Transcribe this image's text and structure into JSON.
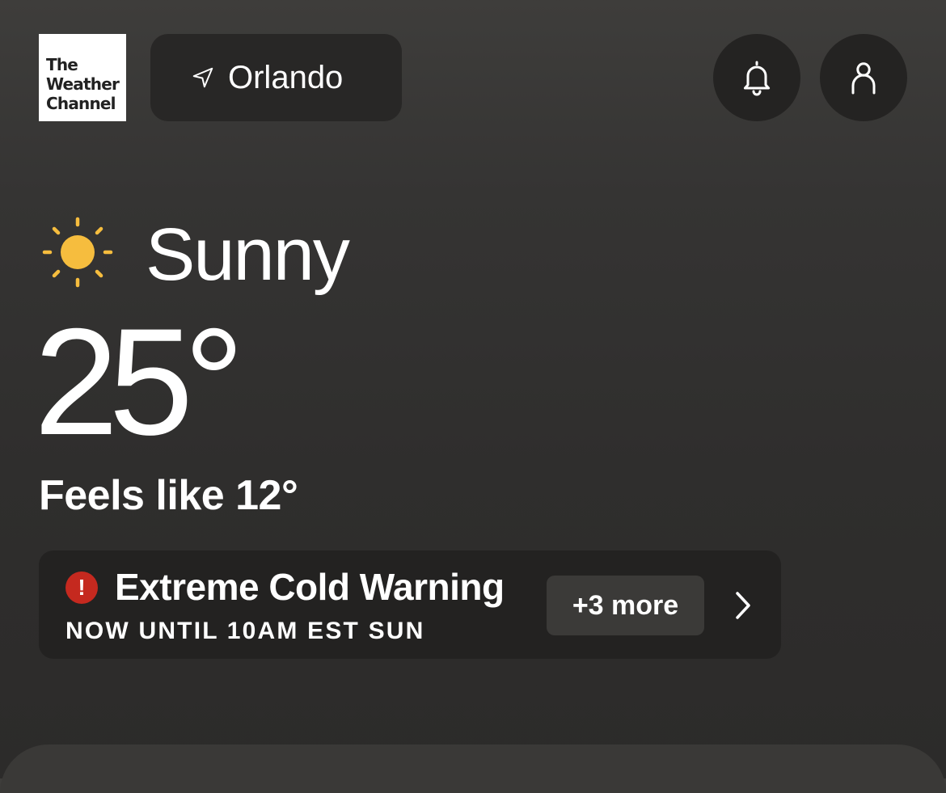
{
  "header": {
    "logo_lines": [
      "The",
      "Weather",
      "Channel"
    ],
    "location": "Orlando",
    "location_icon": "navigation-arrow-icon",
    "notifications_icon": "bell-icon",
    "profile_icon": "person-icon"
  },
  "current": {
    "condition": "Sunny",
    "condition_icon": "sun-icon",
    "temperature": "25°",
    "feels_like": "Feels like 12°"
  },
  "alert": {
    "icon": "exclamation-icon",
    "title": "Extreme Cold Warning",
    "subtitle": "NOW UNTIL 10AM EST SUN",
    "more_label": "+3 more"
  },
  "colors": {
    "sun": "#f6bd3e",
    "alert_red": "#c5291f",
    "background": "#333231"
  }
}
